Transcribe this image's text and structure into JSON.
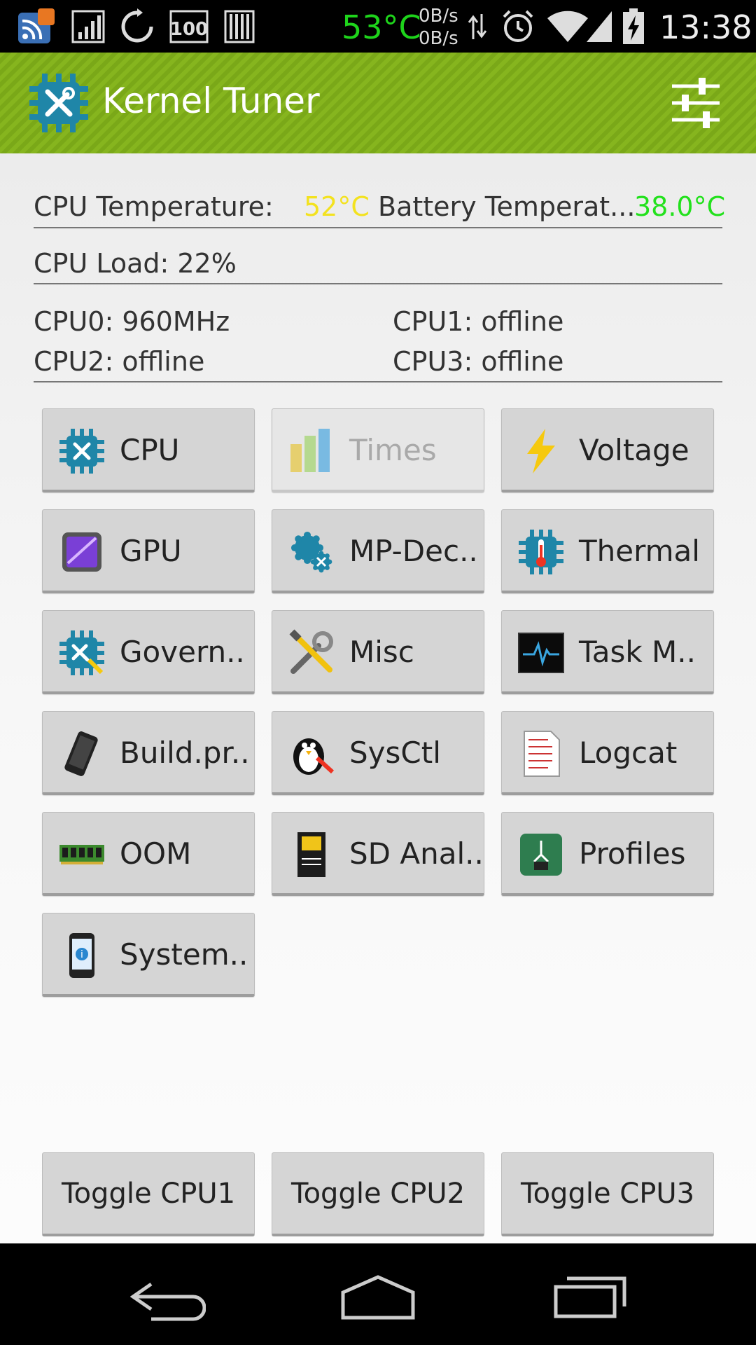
{
  "status_bar": {
    "temperature": "53°C",
    "upload": "0B/s",
    "download": "0B/s",
    "battery_level_icon": "100",
    "time": "13:38"
  },
  "app": {
    "title": "Kernel Tuner"
  },
  "info": {
    "cpu_temp_label": "CPU Temperature:",
    "cpu_temp_value": "52°C",
    "battery_temp_label": "Battery Temperat...",
    "battery_temp_value": "38.0°C",
    "cpu_load": "CPU Load: 22%",
    "cpu0": "CPU0: 960MHz",
    "cpu1": "CPU1: offline",
    "cpu2": "CPU2: offline",
    "cpu3": "CPU3: offline"
  },
  "colors": {
    "actionbar": "#86b51e",
    "cpu_temp": "#f3e21f",
    "battery_temp": "#22e11c",
    "status_temp": "#1ed41b"
  },
  "buttons": [
    {
      "label": "CPU",
      "icon": "cpu-chip-icon",
      "enabled": true
    },
    {
      "label": "Times",
      "icon": "bar-chart-icon",
      "enabled": false
    },
    {
      "label": "Voltage",
      "icon": "lightning-icon",
      "enabled": true
    },
    {
      "label": "GPU",
      "icon": "gpu-chip-icon",
      "enabled": true
    },
    {
      "label": "MP-Dec..",
      "icon": "gears-icon",
      "enabled": true
    },
    {
      "label": "Thermal",
      "icon": "thermometer-gear-icon",
      "enabled": true
    },
    {
      "label": "Govern..",
      "icon": "governor-gear-icon",
      "enabled": true
    },
    {
      "label": "Misc",
      "icon": "tools-icon",
      "enabled": true
    },
    {
      "label": "Task M..",
      "icon": "monitor-pulse-icon",
      "enabled": true
    },
    {
      "label": "Build.pr..",
      "icon": "phone-icon",
      "enabled": true
    },
    {
      "label": "SysCtl",
      "icon": "penguin-icon",
      "enabled": true
    },
    {
      "label": "Logcat",
      "icon": "log-document-icon",
      "enabled": true
    },
    {
      "label": "OOM",
      "icon": "ram-module-icon",
      "enabled": true
    },
    {
      "label": "SD Anal..",
      "icon": "sd-card-icon",
      "enabled": true
    },
    {
      "label": "Profiles",
      "icon": "profile-chip-icon",
      "enabled": true
    },
    {
      "label": "System..",
      "icon": "phone-info-icon",
      "enabled": true
    }
  ],
  "toggles": [
    "Toggle CPU1",
    "Toggle CPU2",
    "Toggle CPU3"
  ],
  "nav": {
    "back": "back-icon",
    "home": "home-icon",
    "recents": "recents-icon"
  }
}
